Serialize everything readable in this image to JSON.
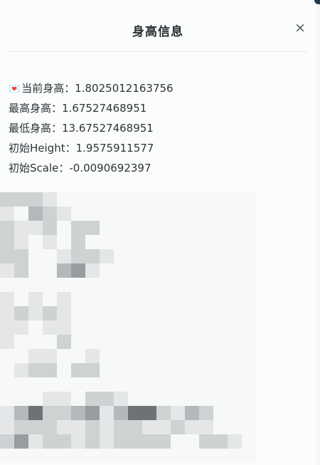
{
  "dialog": {
    "title": "身高信息",
    "close_label": "×"
  },
  "info": {
    "rows": [
      {
        "icon": "💌",
        "label": "当前身高：",
        "value": "1.8025012163756"
      },
      {
        "label": "最高身高：",
        "value": "1.67527468951"
      },
      {
        "label": "最低身高：",
        "value": "13.67527468951"
      },
      {
        "label": "初始Height：",
        "value": "1.9575911577"
      },
      {
        "label": "初始Scale：",
        "value": "-0.0090692397"
      }
    ]
  },
  "mosaic": {
    "palette": [
      "#f7f8f8",
      "#e4e6e7",
      "#cfd2d3",
      "#b5b8ba",
      "#9a9d9f",
      "#6f7274"
    ],
    "grid": [
      [
        2,
        2,
        2,
        1,
        0,
        0,
        0,
        0,
        0,
        0,
        0,
        0,
        0,
        0,
        0,
        0,
        0,
        0
      ],
      [
        1,
        0,
        3,
        2,
        1,
        0,
        0,
        0,
        0,
        0,
        0,
        0,
        0,
        0,
        0,
        0,
        0,
        0
      ],
      [
        2,
        1,
        1,
        2,
        0,
        2,
        2,
        0,
        0,
        0,
        0,
        0,
        0,
        0,
        0,
        0,
        0,
        0
      ],
      [
        2,
        1,
        0,
        1,
        0,
        2,
        0,
        0,
        0,
        0,
        0,
        0,
        0,
        0,
        0,
        0,
        0,
        0
      ],
      [
        2,
        2,
        0,
        0,
        1,
        2,
        2,
        1,
        0,
        0,
        0,
        0,
        0,
        0,
        0,
        0,
        0,
        0
      ],
      [
        1,
        2,
        0,
        0,
        3,
        4,
        1,
        0,
        0,
        0,
        0,
        0,
        0,
        0,
        0,
        0,
        0,
        0
      ],
      [
        0,
        0,
        0,
        0,
        0,
        0,
        0,
        0,
        0,
        0,
        0,
        0,
        0,
        0,
        0,
        0,
        0,
        0
      ],
      [
        1,
        0,
        1,
        0,
        1,
        0,
        0,
        0,
        0,
        0,
        0,
        0,
        0,
        0,
        0,
        0,
        0,
        0
      ],
      [
        1,
        2,
        1,
        2,
        1,
        0,
        0,
        0,
        0,
        0,
        0,
        0,
        0,
        0,
        0,
        0,
        0,
        0
      ],
      [
        1,
        1,
        0,
        1,
        1,
        0,
        0,
        0,
        0,
        0,
        0,
        0,
        0,
        0,
        0,
        0,
        0,
        0
      ],
      [
        1,
        0,
        0,
        0,
        2,
        0,
        0,
        0,
        0,
        0,
        0,
        0,
        0,
        0,
        0,
        0,
        0,
        0
      ],
      [
        0,
        0,
        1,
        1,
        0,
        0,
        1,
        0,
        0,
        0,
        0,
        0,
        0,
        0,
        0,
        0,
        0,
        0
      ],
      [
        0,
        1,
        2,
        2,
        0,
        2,
        2,
        0,
        0,
        0,
        0,
        0,
        0,
        0,
        0,
        0,
        0,
        0
      ],
      [
        0,
        0,
        0,
        0,
        0,
        0,
        0,
        0,
        0,
        0,
        0,
        0,
        0,
        0,
        0,
        0,
        0,
        0
      ],
      [
        0,
        0,
        0,
        1,
        1,
        0,
        2,
        2,
        1,
        0,
        0,
        0,
        0,
        0,
        0,
        0,
        0,
        0
      ],
      [
        1,
        3,
        5,
        2,
        2,
        3,
        4,
        1,
        3,
        5,
        5,
        2,
        1,
        3,
        2,
        0,
        0,
        0
      ],
      [
        1,
        2,
        2,
        2,
        1,
        1,
        2,
        1,
        2,
        2,
        1,
        1,
        2,
        1,
        1,
        0,
        0,
        0
      ],
      [
        2,
        4,
        1,
        2,
        2,
        1,
        2,
        1,
        2,
        2,
        2,
        2,
        0,
        0,
        2,
        2,
        1,
        0
      ],
      [
        0,
        0,
        0,
        0,
        0,
        0,
        0,
        0,
        0,
        0,
        0,
        0,
        0,
        0,
        0,
        0,
        0,
        0
      ]
    ]
  }
}
